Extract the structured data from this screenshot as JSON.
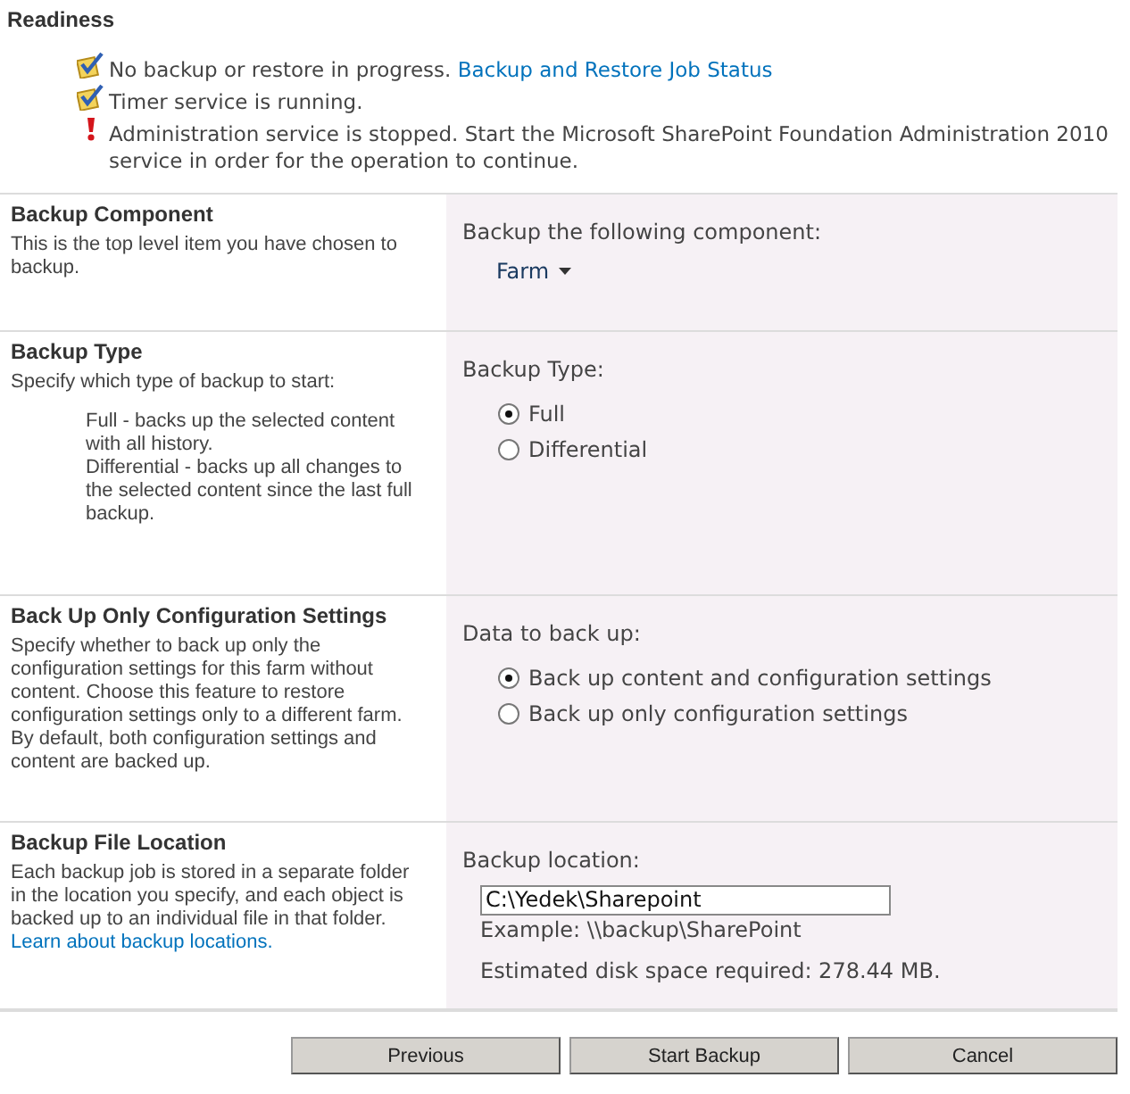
{
  "readiness": {
    "title": "Readiness",
    "items": [
      {
        "kind": "ok",
        "text": "No backup or restore in progress.",
        "link": "Backup and Restore Job Status"
      },
      {
        "kind": "ok",
        "text": "Timer service is running."
      },
      {
        "kind": "error",
        "text": "Administration service is stopped. Start the Microsoft SharePoint Foundation Administration 2010 service in order for the operation to continue."
      }
    ]
  },
  "sections": [
    {
      "title": "Backup Component",
      "description": "This is the top level item you have chosen to backup.",
      "kind": "dropdown",
      "label": "Backup the following component:",
      "value": "Farm"
    },
    {
      "title": "Backup Type",
      "description": "Specify which type of backup to start:",
      "notes": [
        "Full - backs up the selected content with all history.",
        "Differential - backs up all changes to the selected content since the last full backup."
      ],
      "kind": "radio",
      "label": "Backup Type:",
      "options": [
        {
          "label": "Full",
          "selected": true
        },
        {
          "label": "Differential",
          "selected": false
        }
      ]
    },
    {
      "title": "Back Up Only Configuration Settings",
      "description": "Specify whether to back up only the configuration settings for this farm without content. Choose this feature to restore configuration settings only to a different farm. By default, both configuration settings and content are backed up.",
      "kind": "radio",
      "label": "Data to back up:",
      "options": [
        {
          "label": "Back up content and configuration settings",
          "selected": true
        },
        {
          "label": "Back up only configuration settings",
          "selected": false
        }
      ]
    },
    {
      "title": "Backup File Location",
      "description": "Each backup job is stored in a separate folder in the location you specify, and each object is backed up to an individual file in that folder.",
      "link": "Learn about backup locations.",
      "kind": "location",
      "label": "Backup location:",
      "value": "C:\\Yedek\\Sharepoint",
      "example": "Example: \\\\backup\\SharePoint",
      "estimate": "Estimated disk space required: 278.44 MB."
    }
  ],
  "buttons": [
    "Previous",
    "Start Backup",
    "Cancel"
  ]
}
